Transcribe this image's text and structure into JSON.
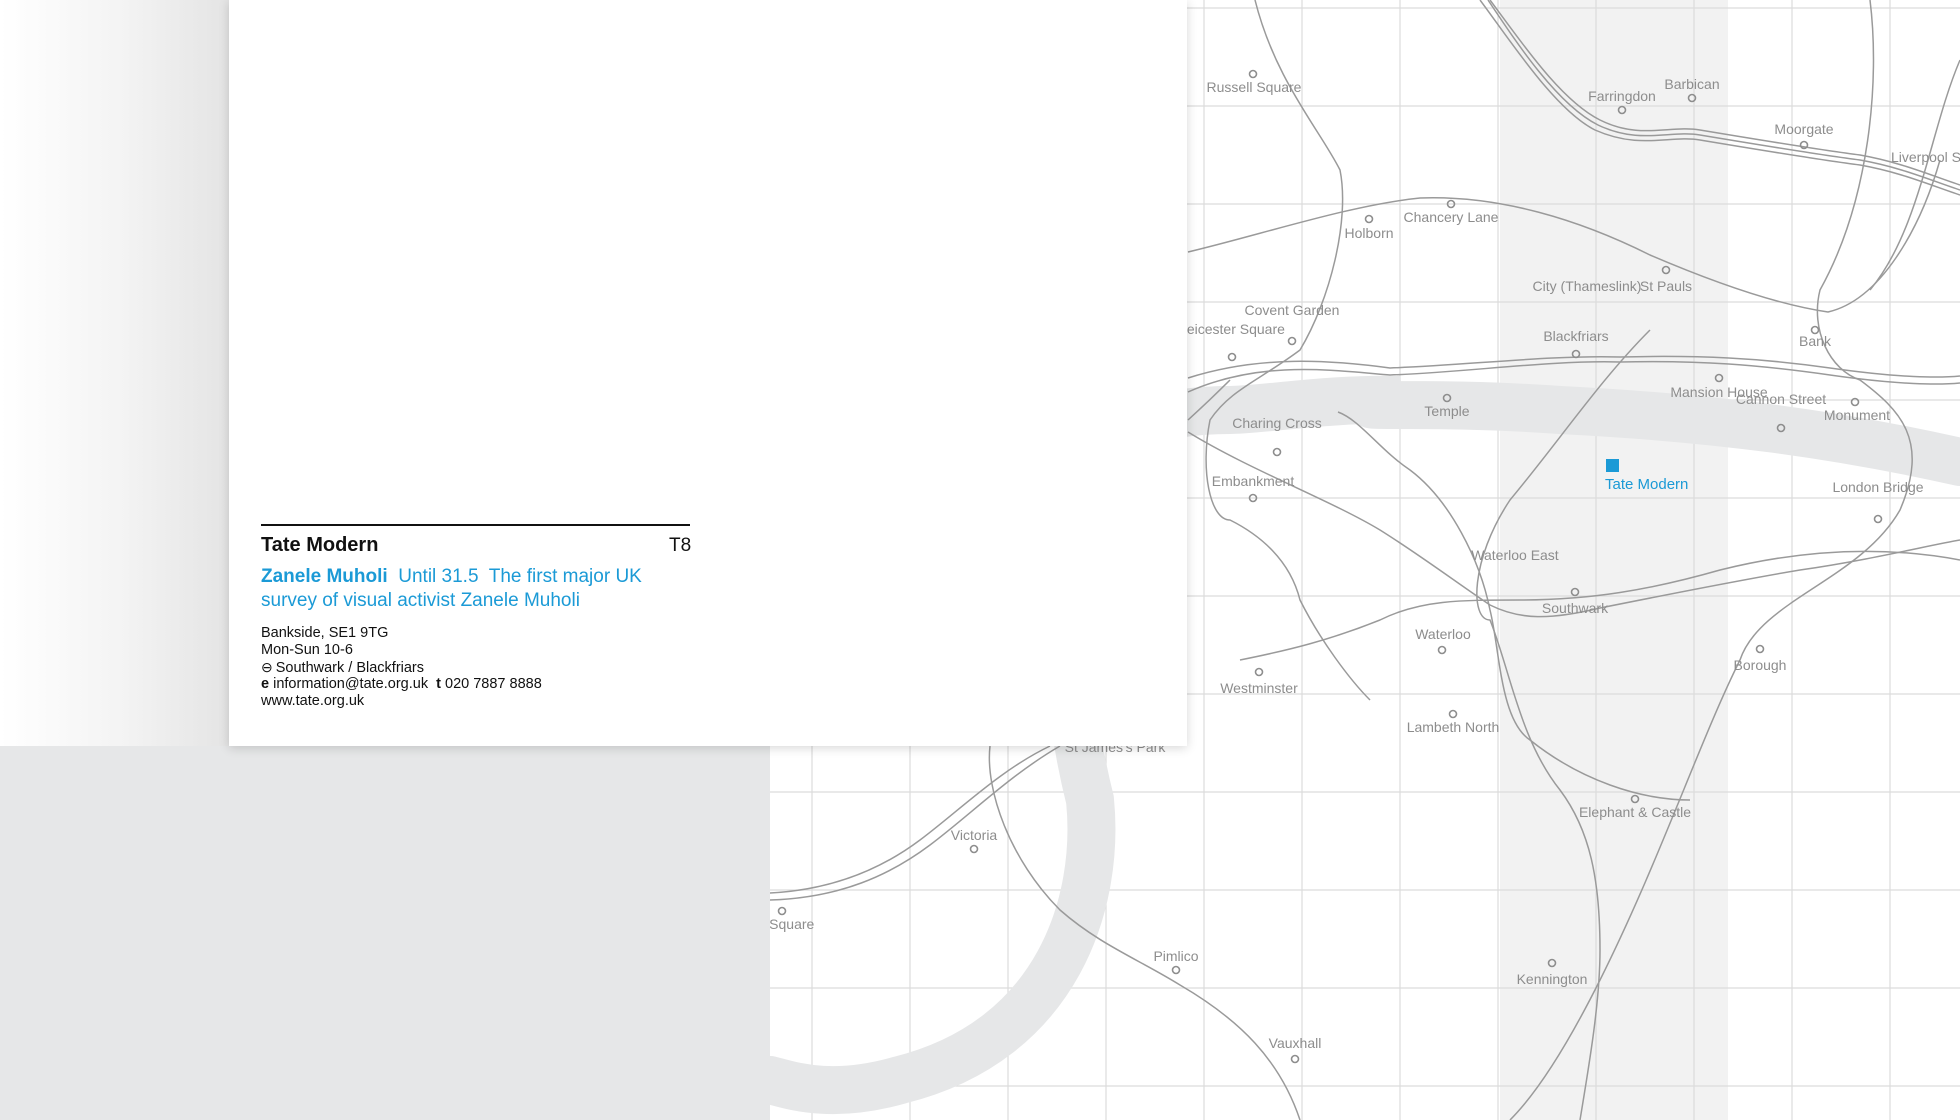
{
  "venue": {
    "name": "Tate Modern",
    "code": "T8",
    "exhibition_title": "Zanele Muholi",
    "exhibition_dates": "Until 31.5",
    "exhibition_description": "The first major UK survey of visual activist Zanele Muholi",
    "address": "Bankside, SE1 9TG",
    "hours": "Mon-Sun 10-6",
    "tube_stations": "Southwark / Blackfriars",
    "email_key": "e",
    "email": "information@tate.org.uk",
    "phone_key": "t",
    "phone": "020 7887 8888",
    "website": "www.tate.org.uk"
  },
  "map": {
    "highlight_label": "Tate Modern",
    "highlight_color": "#1b9ad6",
    "stations": [
      "Russell Square",
      "Farringdon",
      "Barbican",
      "Moorgate",
      "Liverpool Street",
      "Holborn",
      "Chancery Lane",
      "City (Thameslink)",
      "St Pauls",
      "Bank",
      "Covent Garden",
      "Leicester Square",
      "Blackfriars",
      "Mansion House",
      "Cannon Street",
      "Monument",
      "Temple",
      "Charing Cross",
      "Embankment",
      "London Bridge",
      "Waterloo East",
      "Southwark",
      "Waterloo",
      "Westminster",
      "Borough",
      "Lambeth North",
      "St James's Park",
      "Elephant & Castle",
      "Victoria",
      "Sloane Square",
      "Pimlico",
      "Kennington",
      "Vauxhall"
    ]
  },
  "colors": {
    "accent": "#1b9ad6",
    "river": "#e6e7e8",
    "line": "#9a9a9a",
    "grid": "#dcdcdc"
  }
}
